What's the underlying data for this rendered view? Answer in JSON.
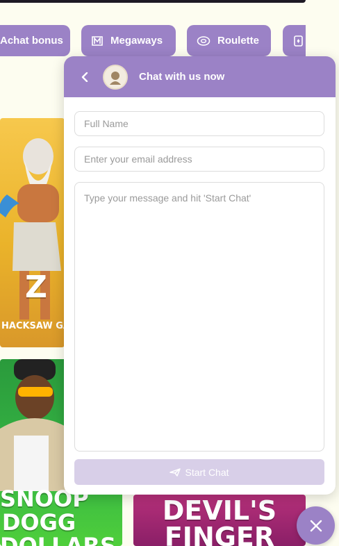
{
  "categories": [
    {
      "label": "Achat bonus",
      "icon": "none"
    },
    {
      "label": "Megaways",
      "icon": "megaways-icon"
    },
    {
      "label": "Roulette",
      "icon": "roulette-icon"
    },
    {
      "label": "",
      "icon": "cards-icon"
    }
  ],
  "games": {
    "zeus": {
      "title_fragment": "Z",
      "provider": "HACKSAW GAMIN"
    },
    "snoop": {
      "title_line1": "SNOOP",
      "title_line2": "DOGG",
      "title_line3": "DOLLARS"
    },
    "devil": {
      "title_line1": "DEVIL'S",
      "title_line2": "FINGER"
    }
  },
  "chat": {
    "title": "Chat with us now",
    "name_placeholder": "Full Name",
    "email_placeholder": "Enter your email address",
    "message_placeholder": "Type your message and hit 'Start Chat'",
    "start_label": "Start Chat"
  },
  "colors": {
    "accent": "#9b82c6",
    "button_disabled": "#d8cfe8",
    "page_bg": "#fdfdf0"
  }
}
